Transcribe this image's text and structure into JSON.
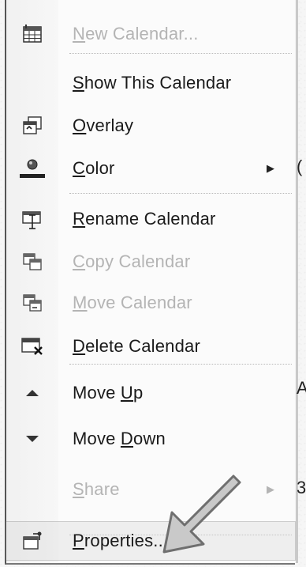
{
  "menu": {
    "items": [
      {
        "id": "new-calendar",
        "prefix": "",
        "underline": "N",
        "rest": "ew Calendar...",
        "disabled": true,
        "submenu": false,
        "icon": "calendar-grid-icon"
      },
      {
        "id": "show-this-calendar",
        "prefix": "",
        "underline": "S",
        "rest": "how This Calendar",
        "disabled": false,
        "submenu": false,
        "icon": ""
      },
      {
        "id": "overlay",
        "prefix": "",
        "underline": "O",
        "rest": "verlay",
        "disabled": false,
        "submenu": false,
        "icon": "overlay-calendar-icon"
      },
      {
        "id": "color",
        "prefix": "",
        "underline": "C",
        "rest": "olor",
        "disabled": false,
        "submenu": true,
        "icon": "color-palette-icon"
      },
      {
        "id": "rename-calendar",
        "prefix": "",
        "underline": "R",
        "rest": "ename Calendar",
        "disabled": false,
        "submenu": false,
        "icon": "rename-icon"
      },
      {
        "id": "copy-calendar",
        "prefix": "",
        "underline": "C",
        "rest": "opy Calendar",
        "disabled": true,
        "submenu": false,
        "icon": "copy-calendar-icon"
      },
      {
        "id": "move-calendar",
        "prefix": "",
        "underline": "M",
        "rest": "ove Calendar",
        "disabled": true,
        "submenu": false,
        "icon": "move-calendar-icon"
      },
      {
        "id": "delete-calendar",
        "prefix": "",
        "underline": "D",
        "rest": "elete Calendar",
        "disabled": false,
        "submenu": false,
        "icon": "delete-calendar-icon"
      },
      {
        "id": "move-up",
        "prefix": "Move ",
        "underline": "U",
        "rest": "p",
        "disabled": false,
        "submenu": false,
        "icon": "triangle-up-icon"
      },
      {
        "id": "move-down",
        "prefix": "Move ",
        "underline": "D",
        "rest": "own",
        "disabled": false,
        "submenu": false,
        "icon": "triangle-down-icon"
      },
      {
        "id": "share",
        "prefix": "",
        "underline": "S",
        "rest": "hare",
        "disabled": true,
        "submenu": true,
        "icon": ""
      },
      {
        "id": "properties",
        "prefix": "",
        "underline": "P",
        "rest": "roperties...",
        "disabled": false,
        "submenu": false,
        "icon": "properties-icon"
      }
    ]
  },
  "edge_marks": [
    "(",
    "A",
    "3"
  ],
  "colors": {
    "text": "#1a1a1a",
    "disabled_text": "#b4b4b4",
    "color_swatch": "#222222"
  }
}
